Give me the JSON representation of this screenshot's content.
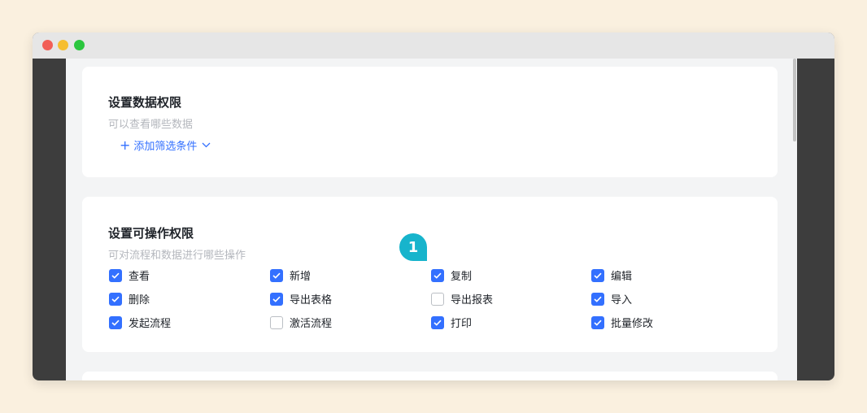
{
  "data_permission": {
    "title": "设置数据权限",
    "subtitle": "可以查看哪些数据",
    "add_filter_label": "添加筛选条件"
  },
  "operation_permission": {
    "title": "设置可操作权限",
    "subtitle": "可对流程和数据进行哪些操作",
    "items": [
      {
        "label": "查看",
        "checked": true
      },
      {
        "label": "新增",
        "checked": true
      },
      {
        "label": "复制",
        "checked": true
      },
      {
        "label": "编辑",
        "checked": true
      },
      {
        "label": "删除",
        "checked": true
      },
      {
        "label": "导出表格",
        "checked": true
      },
      {
        "label": "导出报表",
        "checked": false
      },
      {
        "label": "导入",
        "checked": true
      },
      {
        "label": "发起流程",
        "checked": true
      },
      {
        "label": "激活流程",
        "checked": false
      },
      {
        "label": "打印",
        "checked": true
      },
      {
        "label": "批量修改",
        "checked": true
      }
    ]
  },
  "annotation_badge": "1",
  "colors": {
    "accent": "#3370ff",
    "badge": "#17b4cc",
    "page_background": "#faf0df"
  }
}
